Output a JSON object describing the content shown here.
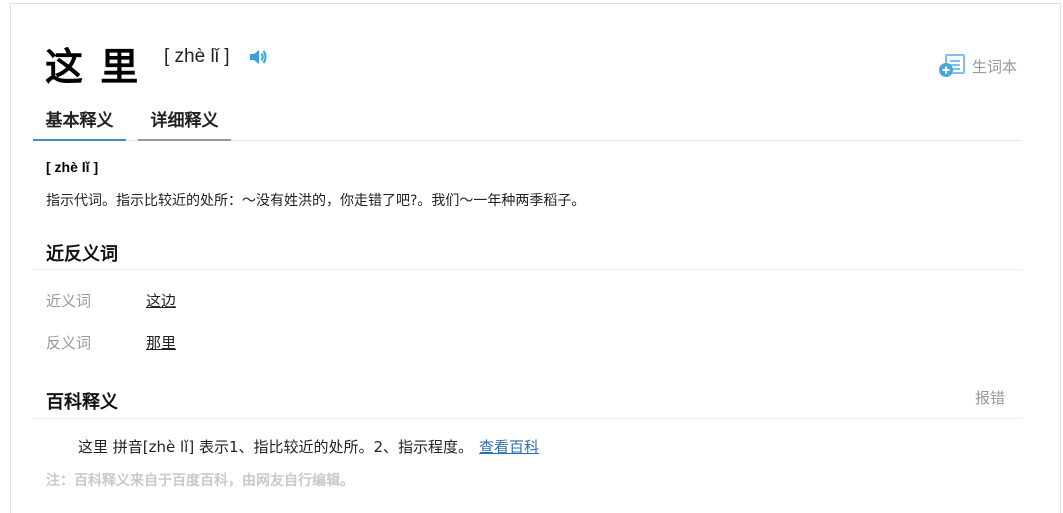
{
  "word": "这 里",
  "pinyin": "[ zhè lǐ ]",
  "vocab_label": "生词本",
  "tabs": [
    "基本释义",
    "详细释义"
  ],
  "basic": {
    "pinyin": "[ zhè lǐ ]",
    "definition": "指示代词。指示比较近的处所：～没有姓洪的，你走错了吧?。我们～一年种两季稻子。"
  },
  "synonyms_section": {
    "title": "近反义词",
    "synonym_label": "近义词",
    "synonym": "这边",
    "antonym_label": "反义词",
    "antonym": "那里"
  },
  "baike": {
    "title": "百科释义",
    "report": "报错",
    "text": "这里 拼音[zhè lǐ] 表示1、指比较近的处所。2、指示程度。",
    "link": "查看百科",
    "note": "注：百科释义来自于百度百科，由网友自行编辑。"
  },
  "colors": {
    "accent": "#3a8fd0",
    "link": "#2a6fb5",
    "muted": "#999999"
  },
  "icons": [
    "speaker-icon",
    "add-vocab-icon"
  ]
}
